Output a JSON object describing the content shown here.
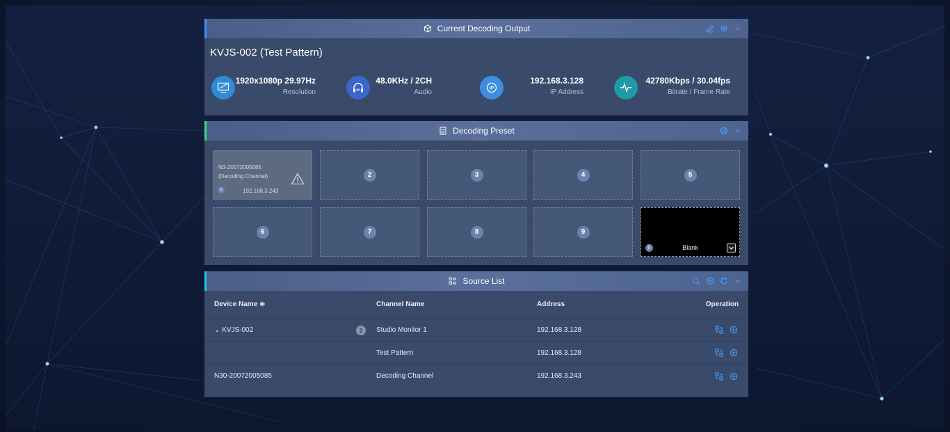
{
  "current_output": {
    "title": "Current Decoding Output",
    "device_title": "KVJS-002 (Test Pattern)",
    "stats": [
      {
        "value": "1920x1080p 29.97Hz",
        "label": "Resolution",
        "icon": "monitor-icon",
        "color": "#2f8bd4"
      },
      {
        "value": "48.0KHz / 2CH",
        "label": "Audio",
        "icon": "headphones-icon",
        "color": "#3a67c8"
      },
      {
        "value": "192.168.3.128",
        "label": "IP Address",
        "icon": "ip-icon",
        "color": "#3c8fe0"
      },
      {
        "value": "42780Kbps / 30.04fps",
        "label": "Bitrate / Frame Rate",
        "icon": "pulse-icon",
        "color": "#1f9aa8"
      }
    ]
  },
  "decoding_preset": {
    "title": "Decoding Preset",
    "active": {
      "line1": "N3-20072005085",
      "line2": "(Decoding Channel)",
      "number": "1",
      "ip": "192.168.3.243"
    },
    "slots": [
      "2",
      "3",
      "4",
      "5",
      "6",
      "7",
      "8",
      "9"
    ],
    "blank": {
      "number": "0",
      "label": "Blank"
    }
  },
  "source_list": {
    "title": "Source List",
    "headers": {
      "device": "Device Name ≑",
      "channel": "Channel Name",
      "address": "Address",
      "operation": "Operation"
    },
    "rows": [
      {
        "device": "⌄  KVJS-002",
        "badge": "2",
        "channel": "Studio Monitor 1",
        "address": "192.168.3.128"
      },
      {
        "device": "",
        "badge": "",
        "channel": "Test Pattern",
        "address": "192.168.3.128"
      },
      {
        "device": "N30-20072005085",
        "badge": "",
        "channel": "Decoding Channel",
        "address": "192.168.3.243"
      }
    ]
  },
  "colors": {
    "accent_blue": "#3f90ff",
    "accent_green": "#3ddc84",
    "accent_cyan": "#22c8e0"
  }
}
